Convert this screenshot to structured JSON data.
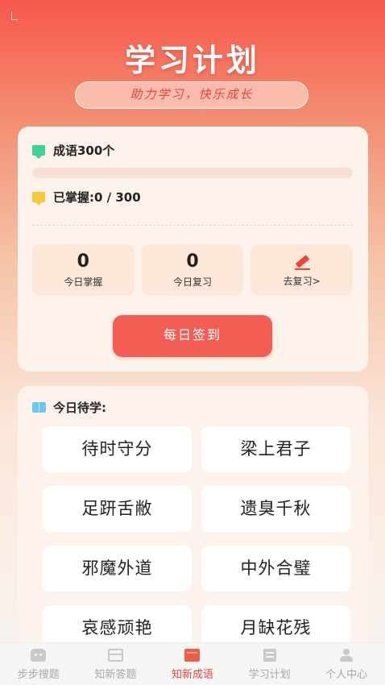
{
  "header": {
    "title": "学习计划",
    "slogan": "助力学习，快乐成长"
  },
  "plan": {
    "goal_label": "成语300个",
    "mastered_label": "已掌握:0 / 300",
    "progress": 0,
    "stats": [
      {
        "value": "0",
        "label": "今日掌握"
      },
      {
        "value": "0",
        "label": "今日复习"
      }
    ],
    "review_link": "去复习>",
    "checkin_button": "每日签到"
  },
  "today": {
    "heading": "今日待学:",
    "idioms": [
      "待时守分",
      "梁上君子",
      "足趼舌敝",
      "遗臭千秋",
      "邪魔外道",
      "中外合璧",
      "哀感顽艳",
      "月缺花残"
    ]
  },
  "tabbar": {
    "tabs": [
      {
        "label": "步步搜题",
        "icon": "robot-icon"
      },
      {
        "label": "知新答题",
        "icon": "quiz-box-icon"
      },
      {
        "label": "知新成语",
        "icon": "book-icon",
        "active": true
      },
      {
        "label": "学习计划",
        "icon": "list-icon"
      },
      {
        "label": "个人中心",
        "icon": "user-icon"
      }
    ]
  },
  "colors": {
    "accent": "#f25e53",
    "goal_flag": "#3ed29a",
    "mastered_flag": "#f8c83a",
    "book_icon": "#6cc8ee"
  }
}
